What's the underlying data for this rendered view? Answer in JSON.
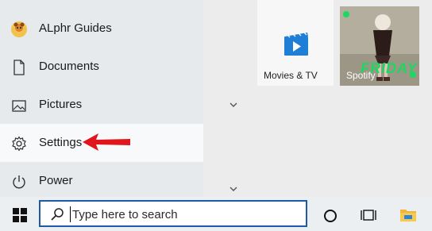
{
  "menu": {
    "user_name": "ALphr Guides",
    "documents": "Documents",
    "pictures": "Pictures",
    "settings": "Settings",
    "power": "Power"
  },
  "tiles": {
    "movies_tv": "Movies & TV",
    "spotify": "Spotify",
    "spotify_art_text": "FRIDAY"
  },
  "taskbar": {
    "search_placeholder": "Type here to search"
  },
  "colors": {
    "accent_blue": "#1e5aa8",
    "arrow_red": "#e0161c",
    "spotify_green": "#1ed760"
  }
}
